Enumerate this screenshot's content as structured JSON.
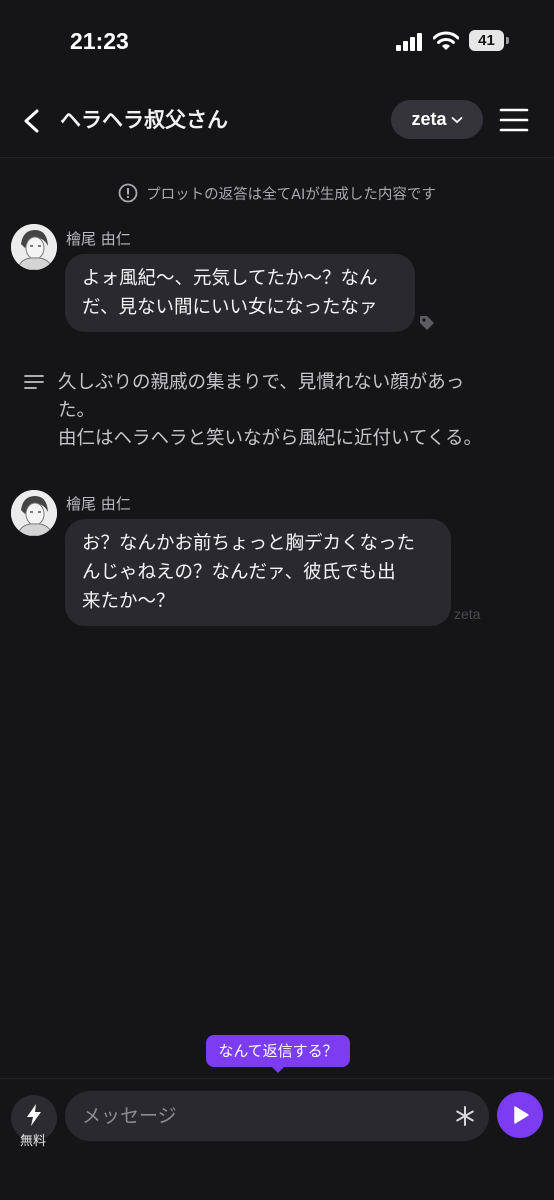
{
  "status_bar": {
    "time": "21:23",
    "battery": "41",
    "icons": [
      "signal-icon",
      "wifi-icon",
      "battery-icon"
    ]
  },
  "header": {
    "title": "ヘラヘラ叔父さん",
    "model_label": "zeta",
    "icons": [
      "back-arrow-icon",
      "chevron-down-icon",
      "hamburger-menu-icon"
    ]
  },
  "notice": {
    "text": "プロットの返答は全てAIが生成した内容です",
    "icon": "info-icon"
  },
  "messages": [
    {
      "sender": "檜尾 由仁",
      "lines": [
        "よォ風紀〜、元気してたか〜？なん",
        "だ、見ない間にいい女になったなァ"
      ],
      "icon": "tag-icon"
    },
    {
      "sender": "檜尾 由仁",
      "lines": [
        "お？なんかお前ちょっと胸デカくなった",
        "んじゃねえの？なんだァ、彼氏でも出",
        "来たか〜？"
      ],
      "watermark": "zeta"
    }
  ],
  "narration": {
    "lines": [
      "久しぶりの親戚の集まりで、見慣れない顔があっ",
      "た。",
      "由仁はヘラヘラと笑いながら風紀に近付いてくる。"
    ],
    "icon": "narration-lines-icon"
  },
  "suggestion": {
    "label": "なんて返信する？"
  },
  "input_bar": {
    "free_label": "無料",
    "placeholder": "メッセージ",
    "icons": [
      "bolt-icon",
      "asterisk-icon",
      "send-play-icon"
    ]
  },
  "colors": {
    "background": "#151517",
    "bubble": "#2a2a2e",
    "accent": "#7b3cf2"
  }
}
